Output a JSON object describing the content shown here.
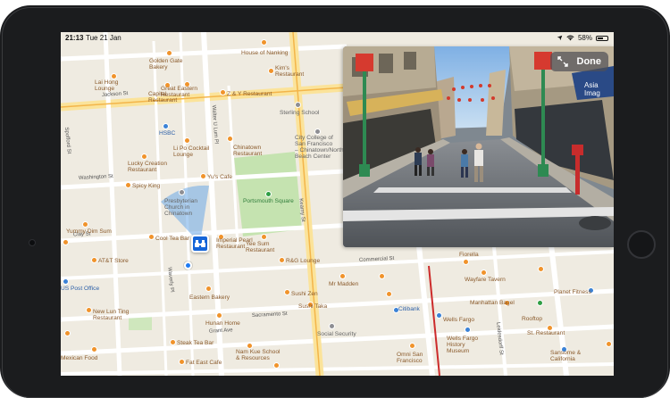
{
  "status_bar": {
    "time": "21:13",
    "date": "Tue 21 Jan",
    "battery": "58%",
    "battery_level": 0.58
  },
  "look_around": {
    "done_label": "Done",
    "sign_text": "Asia\nImag"
  },
  "streets": {
    "jackson": "Jackson St",
    "washington": "Washington St",
    "clay": "Clay St",
    "commercial": "Commercial St",
    "sacramento": "Sacramento St",
    "waverly": "Waverly Pl",
    "spofford": "Spofford St",
    "walter_lum": "Walter U Lum Pl",
    "kearny": "Kearny St",
    "grant": "Grant Ave",
    "leidesdorff": "Leidesdorff St"
  },
  "places": {
    "golden_gate": "Golden Gate\nBakery",
    "house_of_nanking": "House of Nanking",
    "lai_hong": "Lai Hong\nLounge",
    "capital": "Capital\nRestaurant",
    "kims": "Kim's\nRestaurant",
    "great_eastern": "Great Eastern\nRestaurant",
    "z_and_y": "Z & Y Restaurant",
    "sterling": "Sterling School",
    "hsbc": "HSBC",
    "li_po": "Li Po Cocktail\nLounge",
    "chinatown_restaurant": "Chinatown\nRestaurant",
    "city_college": "City College of\nSan Francisco\n– Chinatown/North\nBeach Center",
    "lucky_creation": "Lucky Creation\nRestaurant",
    "yu_cafe": "Yu's Cafe",
    "spicy_king": "Spicy King",
    "portsmouth": "Portsmouth Square",
    "presbyterian": "Presbyterian\nChurch in\nChinatown",
    "yummy_dim_sum": "Yummy Dim Sum",
    "cool_tea_bar": "Cool Tea Bar",
    "imperial_pearl": "Imperial Pearl\nRestaurant",
    "yee_sum": "Yee Sum\nRestaurant",
    "tt_store": "AT&T Store",
    "bag_lounge": "R&G Lounge",
    "post_office": "US Post Office",
    "eastern_bakery": "Eastern Bakery",
    "cafe_de_la_presse": "Café de la\nPresse",
    "mr_madden": "Mr Madden",
    "sushi_zen": "Sushi Zen",
    "wayfare_tavern": "Wayfare Tavern",
    "fiorella": "Fiorella",
    "planet_fitness": "Planet Fitness",
    "new_lun_ting": "New Lun Ting\nRestaurant",
    "hunan_home": "Hunan Home",
    "empress": "Empress\nRestaurant",
    "sushi_taka": "Sushi Taka",
    "manhattan": "Manhattan Bagel",
    "citibank": "Citibank",
    "wells_fargo": "Wells Fargo",
    "rooftop": "Rooftop",
    "social_security": "Social Security",
    "wells_fargo_museum": "Wells Fargo\nHistory\nMuseum",
    "steak_tea": "Steak Tea Bar",
    "fat_eastcafe": "Fat East Cafe",
    "nam_kue": "Nam Kue School\n& Resources",
    "orari_san": "Omni San\nFrancisco",
    "sansome": "Sansome &\nCalifornia",
    "bar_bocce": "Bar Bocce",
    "ice": "ICE",
    "sigma": "Sigma\nRestaurant",
    "mexican": "Mexican Food",
    "st_restaurant": "St. Restaurant",
    "espresso_tea": "Espresso Tea",
    "inn_lounge": "Inn Lounge",
    "clay_cafe": "Clay Cafe",
    "lolo_tea": "Lolo Tea"
  },
  "icons": {
    "binoculars": "binoculars-icon",
    "expand": "expand-icon",
    "wifi": "wifi-icon",
    "location": "location-arrow-icon"
  },
  "colors": {
    "map_background": "#f1ede3",
    "road": "#ffffff",
    "major_road": "#f9d77e",
    "park": "#c5e3b0",
    "accent_blue": "#1e7bf3",
    "poi_orange": "#f0932b",
    "transit_red": "#cc2b2b"
  }
}
